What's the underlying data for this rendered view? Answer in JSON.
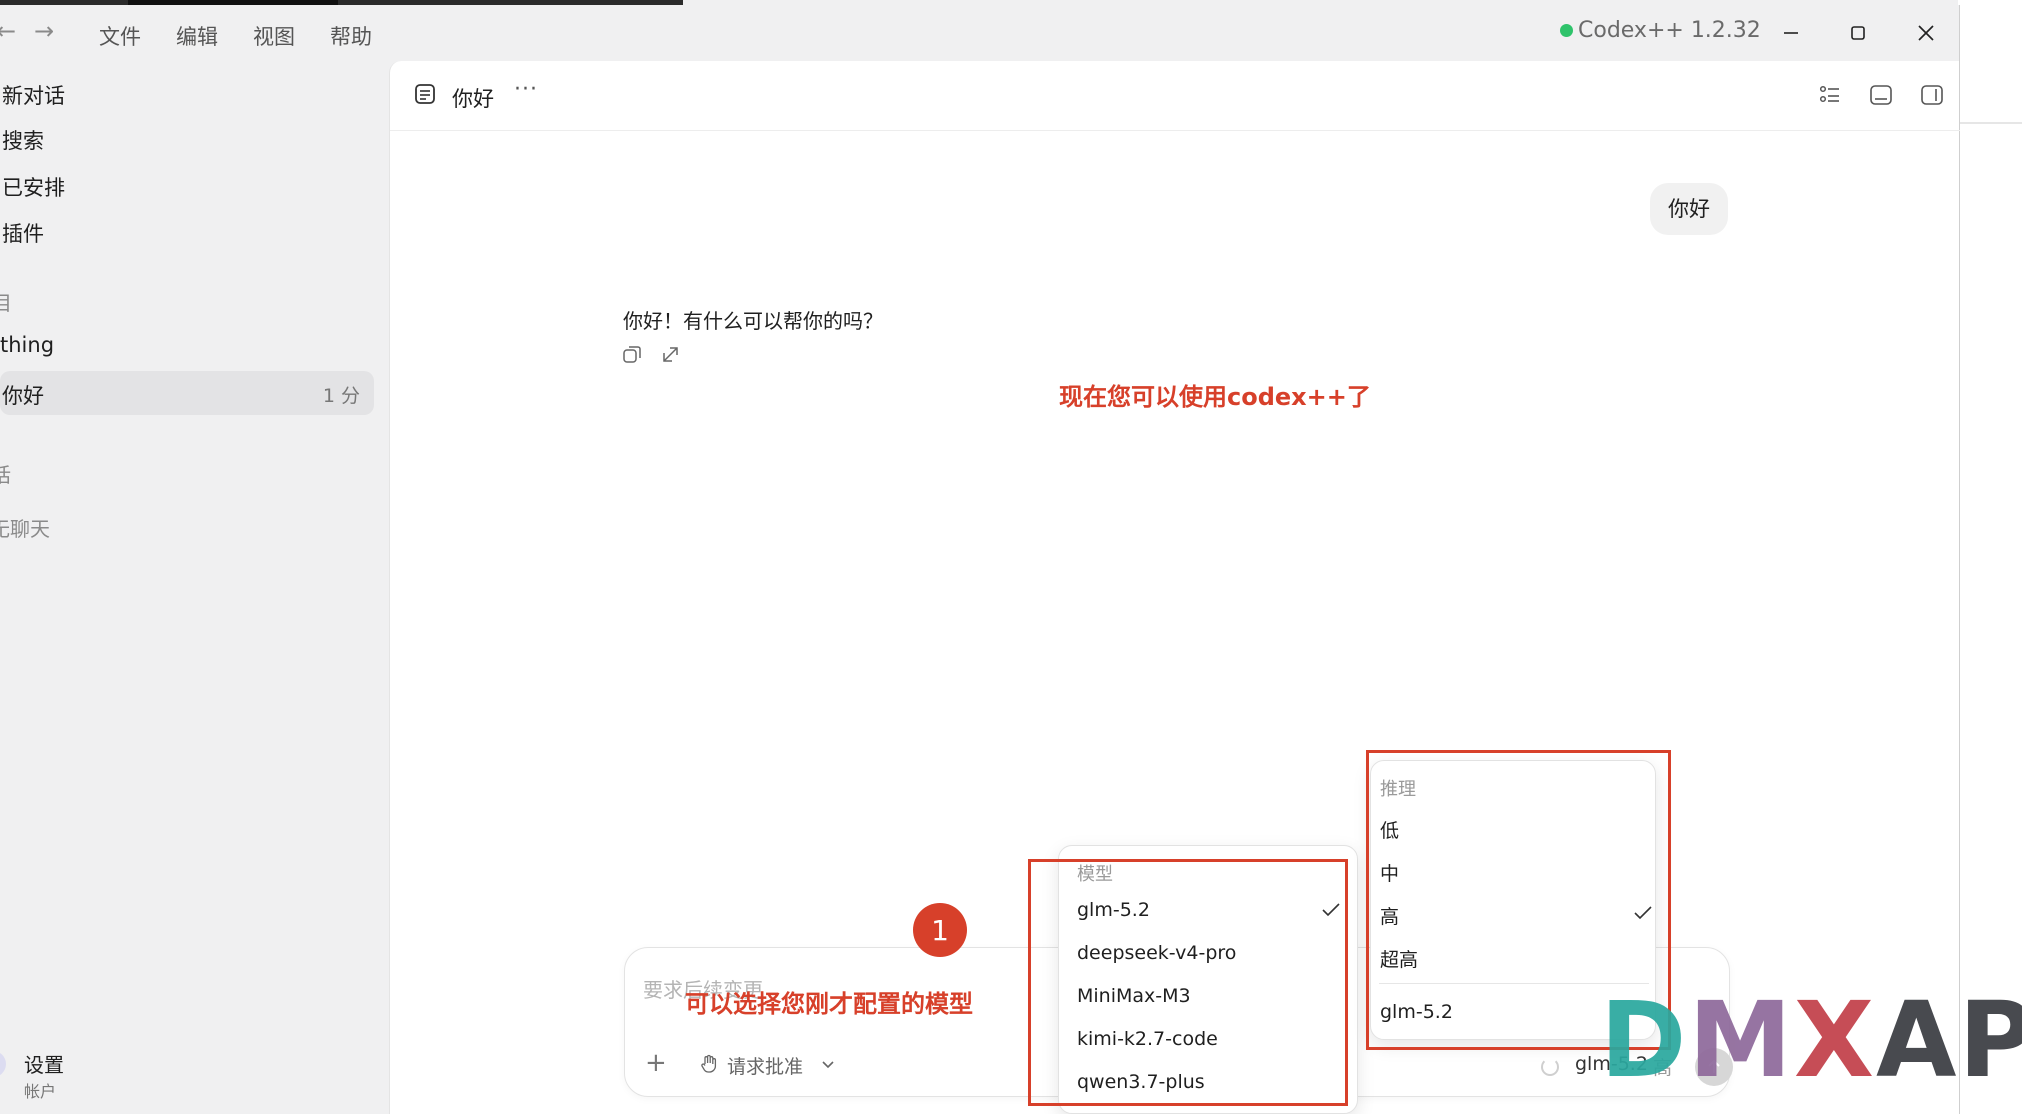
{
  "titlebar": {
    "menu": [
      "文件",
      "编辑",
      "视图",
      "帮助"
    ],
    "app_title": "Codex++ 1.2.32"
  },
  "sidebar": {
    "actions": [
      "新对话",
      "搜索",
      "已安排",
      "插件"
    ],
    "section_projects": "目",
    "project_name": "thing",
    "active_thread": {
      "title": "你好",
      "time": "1 分"
    },
    "section_chats": "话",
    "empty_chats": "无聊天",
    "settings": "设置",
    "account": "帐户"
  },
  "conversation": {
    "title": "你好",
    "more": "···",
    "user_message": "你好",
    "assistant_message": "你好！有什么可以帮你的吗？"
  },
  "composer": {
    "placeholder": "要求后续变更",
    "plus": "+",
    "approval_label": "请求批准",
    "model_selected": "glm-5.2",
    "effort_selected": "高"
  },
  "model_menu": {
    "heading": "模型",
    "options": [
      "glm-5.2",
      "deepseek-v4-pro",
      "MiniMax-M3",
      "kimi-k2.7-code",
      "qwen3.7-plus"
    ],
    "selected": "glm-5.2"
  },
  "reasoning_menu": {
    "heading": "推理",
    "options": [
      "低",
      "中",
      "高",
      "超高"
    ],
    "selected": "高",
    "footer_model": "glm-5.2"
  },
  "annotations": {
    "main": "现在您可以使用codex++了",
    "choose_model": "可以选择您刚才配置的模型",
    "step": "1"
  },
  "watermark": {
    "d": "D",
    "m": "M",
    "x": "X",
    "api": "API"
  },
  "colors": {
    "accent_red": "#d7402a",
    "status_green": "#2fc36b"
  }
}
